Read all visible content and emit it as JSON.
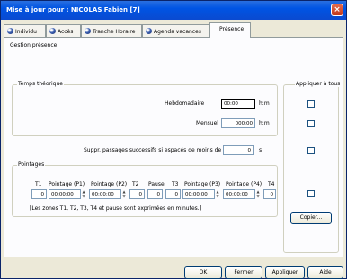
{
  "window": {
    "title": "Mise à jour pour : NICOLAS Fabien [7]",
    "close": "×"
  },
  "tabs": [
    {
      "label": "Individu"
    },
    {
      "label": "Accès"
    },
    {
      "label": "Tranche Horaire"
    },
    {
      "label": "Agenda vacances"
    },
    {
      "label": "Présence"
    }
  ],
  "gestion_label": "Gestion présence",
  "temps": {
    "title": "Temps théorique",
    "hebdo_label": "Hebdomadaire",
    "hebdo_value": "00:00",
    "mensuel_label": "Mensuel",
    "mensuel_value": "000:00",
    "unit": "h:m"
  },
  "appliquer_tous": "Appliquer à tous",
  "suppr": {
    "label": "Suppr. passages successifs si espacés de moins de",
    "value": "0",
    "unit": "s"
  },
  "pointages": {
    "title": "Pointages",
    "headers": [
      "T1",
      "Pointage (P1)",
      "Pointage (P2)",
      "T2",
      "Pause",
      "T3",
      "Pointage (P3)",
      "Pointage (P4)",
      "T4"
    ],
    "values": [
      "0",
      "00:00:00",
      "00:00:00",
      "0",
      "0",
      "0",
      "00:00:00",
      "00:00:00",
      "0"
    ],
    "note": "[Les zones T1, T2, T3, T4 et pause sont exprimées en minutes.]"
  },
  "copier_label": "Copier...",
  "footer": {
    "ok": "OK",
    "fermer": "Fermer",
    "appliquer": "Appliquer",
    "aide": "Aide"
  }
}
